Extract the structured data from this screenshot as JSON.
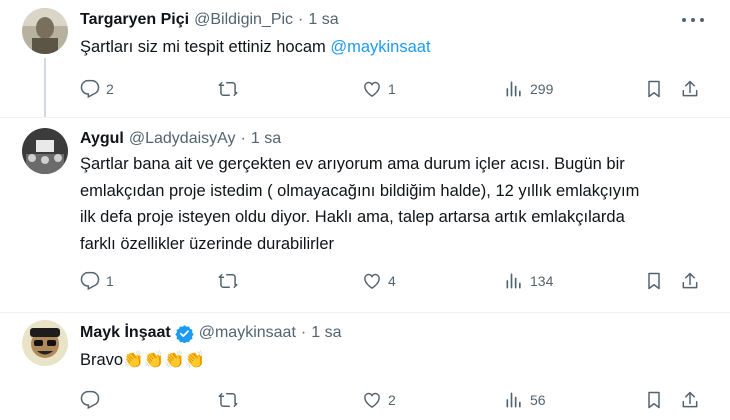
{
  "tweets": [
    {
      "name": "Targaryen Piçi",
      "handle": "@Bildigin_Pic",
      "separator": "·",
      "time": "1 sa",
      "text": "Şartları siz mi tespit ettiniz hocam ",
      "mention": "@maykinsaat",
      "replies": "2",
      "retweets": "",
      "likes": "1",
      "views": "299"
    },
    {
      "name": "Aygul",
      "handle": "@LadydaisyAy",
      "separator": "·",
      "time": "1 sa",
      "lines": [
        "Şartlar bana ait ve gerçekten ev arıyorum ama durum içler acısı. Bugün bir",
        "emlakçıdan proje istedim ( olmayacağını bildiğim halde), 12 yıllık emlakçıyım",
        "ilk defa proje isteyen oldu diyor. Haklı ama, talep artarsa artık emlakçılarda",
        "farklı özellikler üzerinde durabilirler"
      ],
      "replies": "1",
      "retweets": "",
      "likes": "4",
      "views": "134"
    },
    {
      "name": "Mayk İnşaat",
      "handle": "@maykinsaat",
      "separator": "·",
      "time": "1 sa",
      "text": "Bravo",
      "emoji": "👏👏👏👏",
      "replies": "",
      "retweets": "",
      "likes": "2",
      "views": "56"
    }
  ],
  "icons": {
    "reply": "reply-icon",
    "retweet": "retweet-icon",
    "like": "heart-icon",
    "views": "views-icon",
    "bookmark": "bookmark-icon",
    "share": "share-icon",
    "more": "more-icon",
    "verified": "verified-badge-icon"
  },
  "colors": {
    "mention": "#1d9bf0",
    "muted": "#536471",
    "verified": "#1d9bf0",
    "clap": "#f7c948"
  }
}
